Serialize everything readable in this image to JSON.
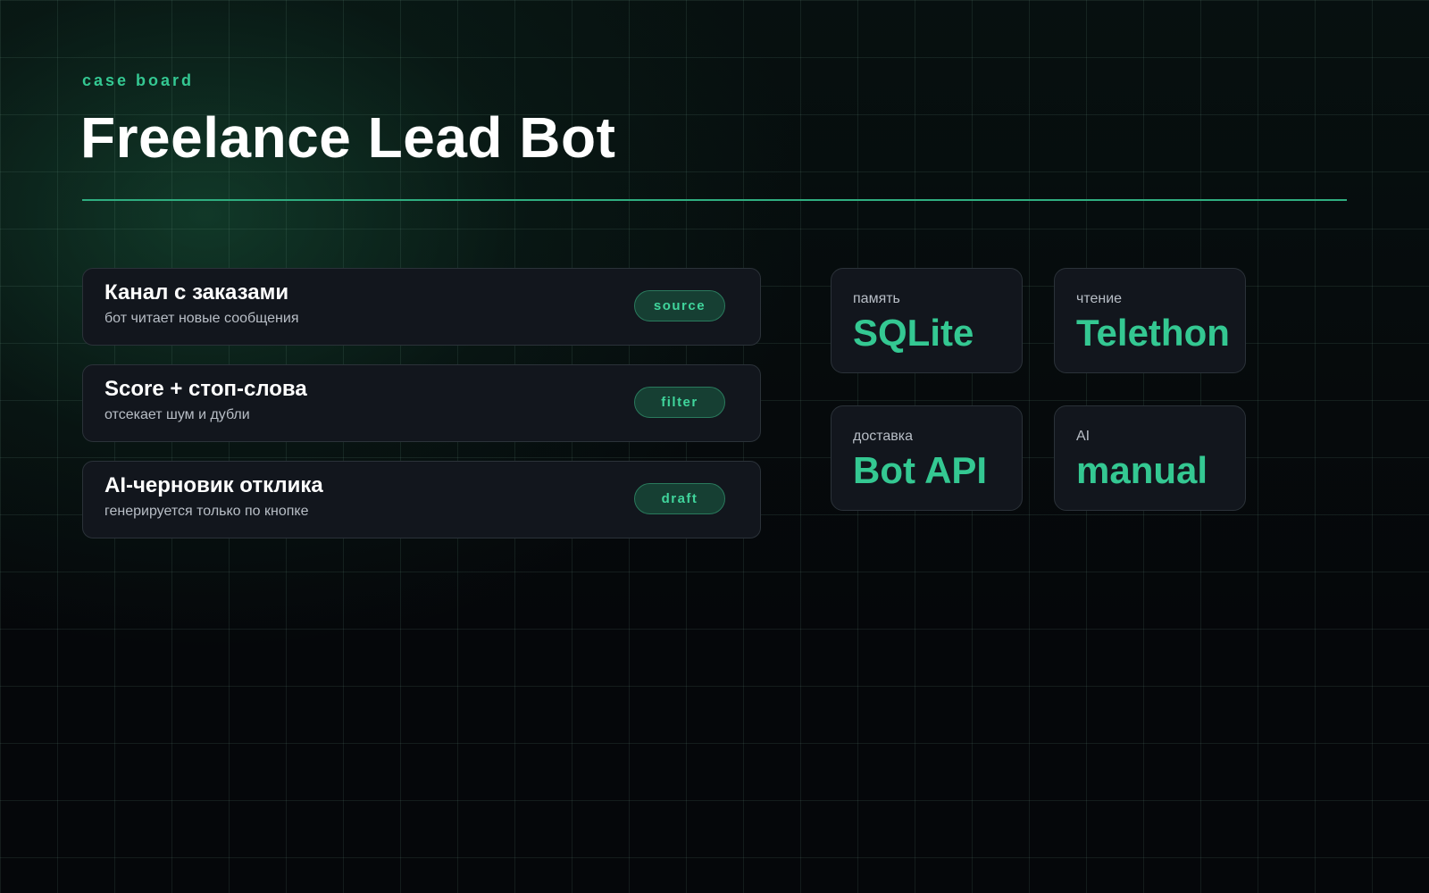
{
  "header": {
    "eyebrow": "case board",
    "title": "Freelance Lead Bot"
  },
  "pipeline": [
    {
      "title": "Канал с заказами",
      "subtitle": "бот читает новые сообщения",
      "badge": "source"
    },
    {
      "title": "Score + стоп-слова",
      "subtitle": "отсекает шум и дубли",
      "badge": "filter"
    },
    {
      "title": "AI-черновик отклика",
      "subtitle": "генерируется только по кнопке",
      "badge": "draft"
    }
  ],
  "stats": [
    {
      "label": "память",
      "value": "SQLite"
    },
    {
      "label": "чтение",
      "value": "Telethon"
    },
    {
      "label": "доставка",
      "value": "Bot API"
    },
    {
      "label": "AI",
      "value": "manual"
    }
  ],
  "colors": {
    "accent": "#34c892",
    "background": "#05070a",
    "card": "#12161d",
    "badge_bg": "#163f33"
  }
}
